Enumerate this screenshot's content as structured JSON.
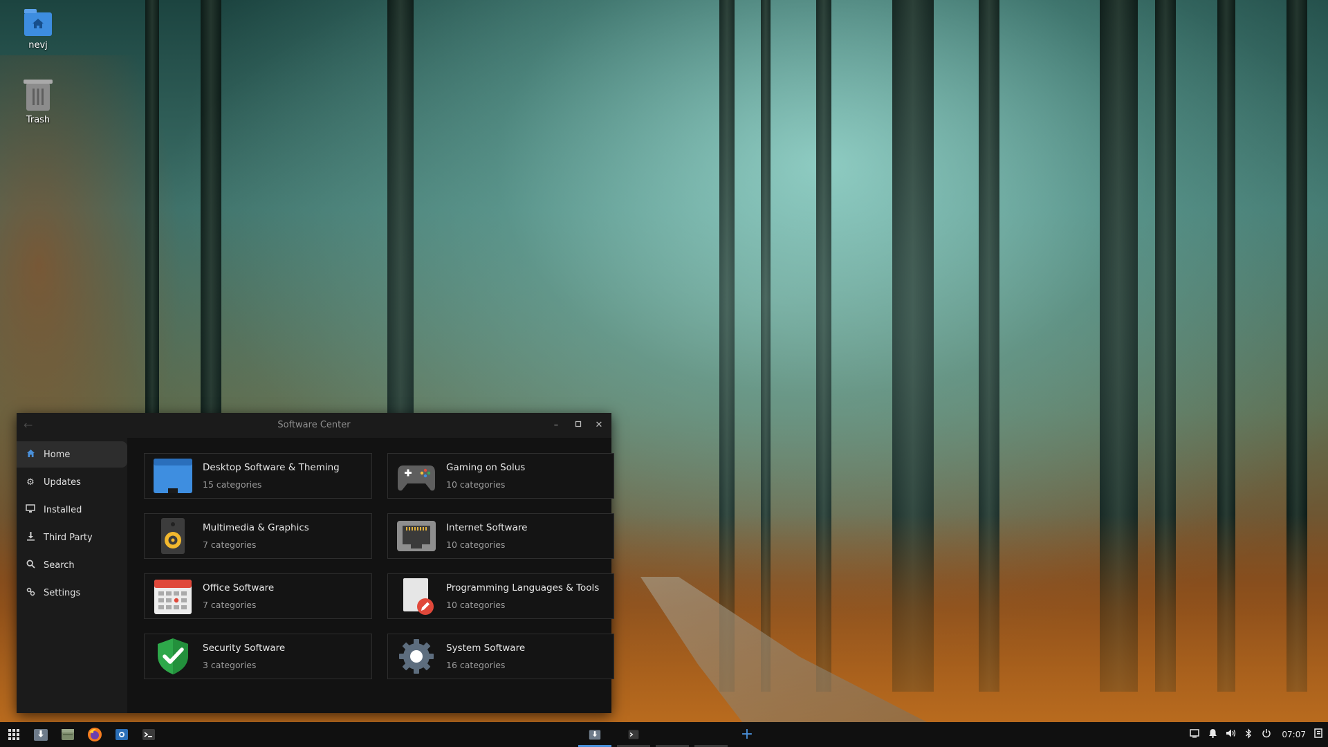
{
  "desktop": {
    "icons": [
      {
        "label": "nevj",
        "icon": "home-folder-icon"
      },
      {
        "label": "Trash",
        "icon": "trash-icon"
      }
    ]
  },
  "window": {
    "title": "Software Center",
    "back_icon": "back-arrow-icon",
    "controls": [
      "minimize",
      "maximize",
      "close"
    ]
  },
  "sidebar": {
    "items": [
      {
        "label": "Home",
        "icon": "home-icon",
        "active": true
      },
      {
        "label": "Updates",
        "icon": "updates-gear-icon"
      },
      {
        "label": "Installed",
        "icon": "monitor-icon"
      },
      {
        "label": "Third Party",
        "icon": "download-icon"
      },
      {
        "label": "Search",
        "icon": "search-icon"
      },
      {
        "label": "Settings",
        "icon": "settings-icon"
      }
    ]
  },
  "categories": [
    {
      "name": "Desktop Software & Theming",
      "count": "15 categories",
      "icon": "desktop-window-icon"
    },
    {
      "name": "Gaming on Solus",
      "count": "10 categories",
      "icon": "gamepad-icon"
    },
    {
      "name": "Multimedia & Graphics",
      "count": "7 categories",
      "icon": "speaker-icon"
    },
    {
      "name": "Internet Software",
      "count": "10 categories",
      "icon": "network-port-icon"
    },
    {
      "name": "Office Software",
      "count": "7 categories",
      "icon": "calendar-icon"
    },
    {
      "name": "Programming Languages & Tools",
      "count": "10 categories",
      "icon": "document-edit-icon"
    },
    {
      "name": "Security Software",
      "count": "3 categories",
      "icon": "shield-check-icon"
    },
    {
      "name": "System Software",
      "count": "16 categories",
      "icon": "system-gear-icon"
    }
  ],
  "taskbar": {
    "launchers": [
      "app-grid-icon",
      "software-center-icon",
      "files-icon",
      "firefox-icon",
      "screenshot-icon",
      "terminal-icon"
    ],
    "tasks": [
      {
        "icon": "software-center-icon",
        "active": true
      },
      {
        "icon": "terminal-icon",
        "active": false
      },
      {
        "icon": "",
        "active": false
      },
      {
        "icon": "",
        "active": false
      }
    ],
    "new_workspace_icon": "plus-icon",
    "tray_icons": [
      "screen-icon",
      "bell-icon",
      "volume-icon",
      "bluetooth-icon",
      "power-icon"
    ],
    "clock": "07:07",
    "raven_icon": "raven-panel-icon"
  },
  "colors": {
    "accent": "#4a90d9",
    "window_bg": "#121212",
    "sidebar_bg": "#1b1b1b"
  }
}
